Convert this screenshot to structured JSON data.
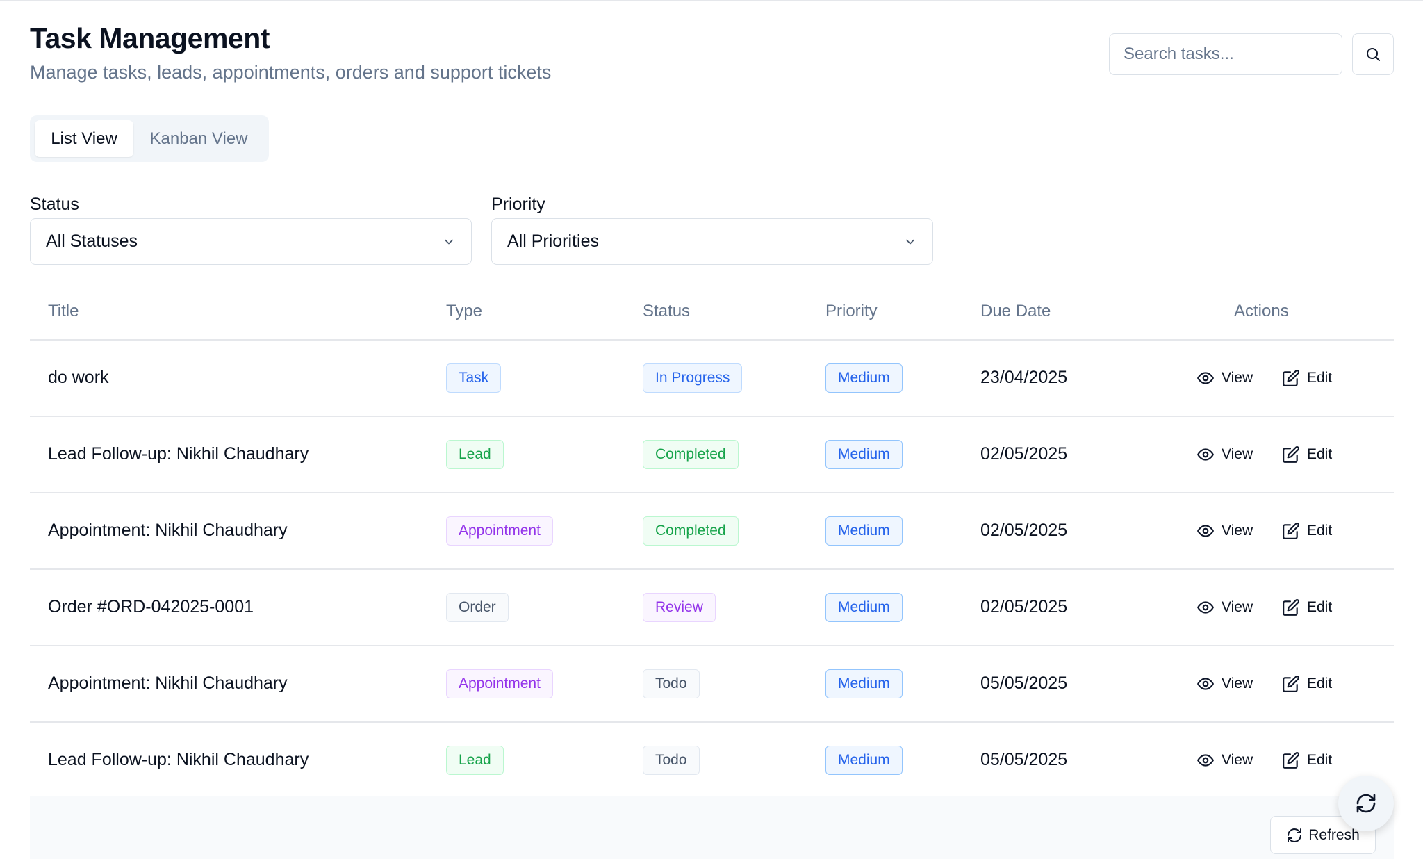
{
  "header": {
    "title": "Task Management",
    "subtitle": "Manage tasks, leads, appointments, orders and support tickets"
  },
  "search": {
    "placeholder": "Search tasks...",
    "value": "",
    "button_icon": "search-icon"
  },
  "tabs": [
    {
      "label": "List View",
      "active": true
    },
    {
      "label": "Kanban View",
      "active": false
    }
  ],
  "filters": {
    "status": {
      "label": "Status",
      "selected": "All Statuses"
    },
    "priority": {
      "label": "Priority",
      "selected": "All Priorities"
    }
  },
  "table": {
    "columns": [
      "Title",
      "Type",
      "Status",
      "Priority",
      "Due Date",
      "Actions"
    ],
    "rows": [
      {
        "title": "do work",
        "type": "Task",
        "status": "In Progress",
        "priority": "Medium",
        "due": "23/04/2025",
        "view": "View",
        "edit": "Edit"
      },
      {
        "title": "Lead Follow-up: Nikhil Chaudhary",
        "type": "Lead",
        "status": "Completed",
        "priority": "Medium",
        "due": "02/05/2025",
        "view": "View",
        "edit": "Edit"
      },
      {
        "title": "Appointment: Nikhil Chaudhary",
        "type": "Appointment",
        "status": "Completed",
        "priority": "Medium",
        "due": "02/05/2025",
        "view": "View",
        "edit": "Edit"
      },
      {
        "title": "Order #ORD-042025-0001",
        "type": "Order",
        "status": "Review",
        "priority": "Medium",
        "due": "02/05/2025",
        "view": "View",
        "edit": "Edit"
      },
      {
        "title": "Appointment: Nikhil Chaudhary",
        "type": "Appointment",
        "status": "Todo",
        "priority": "Medium",
        "due": "05/05/2025",
        "view": "View",
        "edit": "Edit"
      },
      {
        "title": "Lead Follow-up: Nikhil Chaudhary",
        "type": "Lead",
        "status": "Todo",
        "priority": "Medium",
        "due": "05/05/2025",
        "view": "View",
        "edit": "Edit"
      }
    ]
  },
  "footer": {
    "refresh_label": "Refresh",
    "fab_icon": "refresh-icon"
  },
  "colors": {
    "blue": "#2563eb",
    "green": "#16a34a",
    "purple": "#9333ea",
    "gray": "#475569"
  }
}
